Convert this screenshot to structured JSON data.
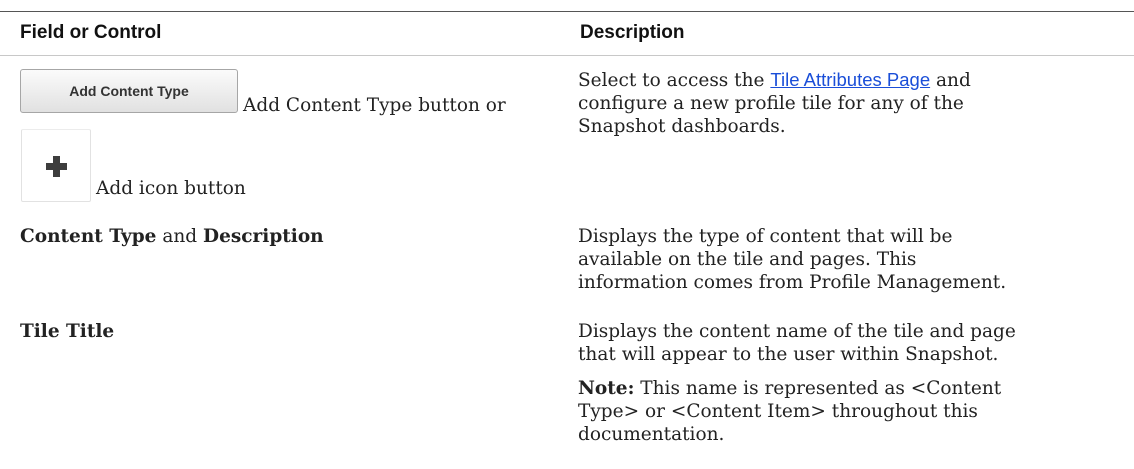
{
  "header": {
    "field_col": "Field or Control",
    "description_col": "Description"
  },
  "rows": [
    {
      "button_label": "Add Content Type",
      "button_suffix": "Add Content Type button or",
      "icon": "plus-icon",
      "icon_suffix": "Add icon button",
      "desc_prefix": "Select to access the",
      "desc_link": "Tile Attributes Page",
      "desc_line1_end": "and",
      "desc_line2": "configure a new profile tile for any of the",
      "desc_line3": "Snapshot dashboards."
    },
    {
      "field_bold1": "Content Type",
      "field_and": "and",
      "field_bold2": "Description",
      "desc_line1": "Displays the type of content that will be",
      "desc_line2": "available on the tile and pages. This",
      "desc_line3": "information comes from Profile Management."
    },
    {
      "field_bold": "Tile Title",
      "desc_line1": "Displays the content name of the tile and page",
      "desc_line2": "that will appear to the user within Snapshot.",
      "note_label": "Note:",
      "note_line1": "This name is represented as <Content",
      "note_line2": "Type> or <Content Item> throughout this",
      "note_line3": "documentation."
    }
  ],
  "colors": {
    "link": "#1a4ed8",
    "rule": "#555555"
  }
}
